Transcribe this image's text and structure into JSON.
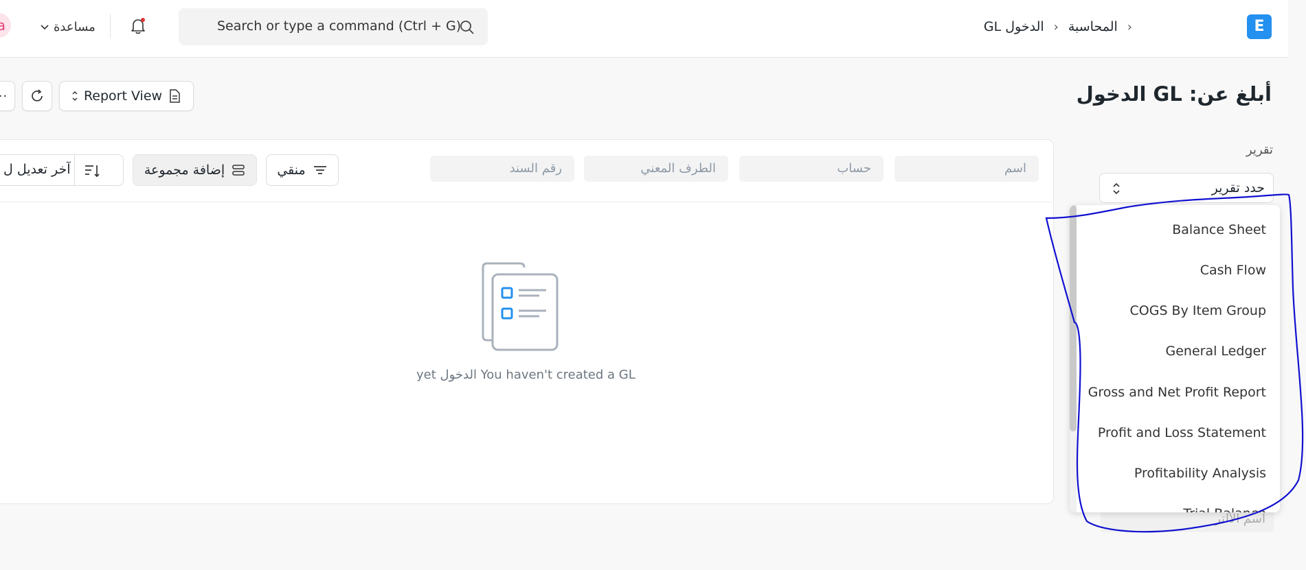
{
  "navbar": {
    "avatar_letter": "a",
    "help_label": "مساعدة",
    "search_placeholder": "Search or type a command (Ctrl + G)",
    "breadcrumbs": [
      "المحاسبة",
      "GL الدخول"
    ],
    "logo_letter": "E"
  },
  "page": {
    "title": "أبلغ عن: GL الدخول",
    "report_view_label": "Report View"
  },
  "filters": {
    "name_placeholder": "اسم",
    "account_placeholder": "حساب",
    "party_placeholder": "الطرف المعني",
    "voucher_placeholder": "رقم السند",
    "filter_label": "منقي",
    "add_group_label": "إضافة مجموعة",
    "sort_label": "آخر تعديل ل"
  },
  "empty_state": {
    "message": "yet الدخول You haven't created a GL"
  },
  "sidebar": {
    "report_label": "تقرير",
    "select_value": "حدد تقرير",
    "assigned_placeholder": "اسم الألتر",
    "dropdown_options": [
      "Balance Sheet",
      "Cash Flow",
      "COGS By Item Group",
      "General Ledger",
      "Gross and Net Profit Report",
      "Profit and Loss Statement",
      "Profitability Analysis",
      "Trial Balance"
    ]
  },
  "colors": {
    "brand": "#2490ef",
    "annotation": "#1010d0",
    "notification_dot": "#e03636"
  }
}
